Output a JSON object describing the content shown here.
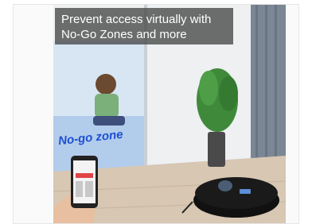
{
  "caption": {
    "line1": "Prevent access virtually with",
    "line2": "No-Go Zones and more"
  },
  "zone_label": "No-go zone",
  "colors": {
    "zone_blue": "#1e50d2",
    "caption_bg": "#464646",
    "robot_body": "#1a1a1a"
  }
}
